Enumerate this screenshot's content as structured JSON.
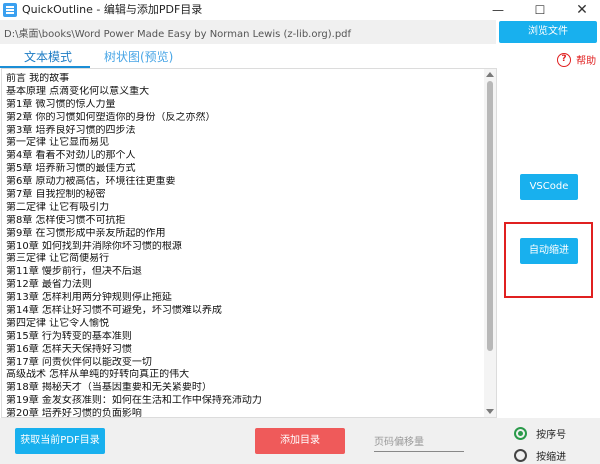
{
  "window": {
    "title": "QuickOutline - 编辑与添加PDF目录",
    "minimize": "—",
    "maximize": "☐",
    "close": "✕"
  },
  "toolbar": {
    "path": "D:\\桌面\\books\\Word Power Made Easy by Norman Lewis (z-lib.org).pdf",
    "browse_label": "浏览文件"
  },
  "tabs": [
    {
      "label": "文本模式",
      "active": true
    },
    {
      "label": "树状图(预览)",
      "active": false
    }
  ],
  "help": {
    "icon": "?",
    "label": "帮助"
  },
  "editor_lines": [
    "前言   我的故事",
    "基本原理 点滴变化何以意义重大",
    "第1章   微习惯的惊人力量",
    "第2章   你的习惯如何塑造你的身份（反之亦然）",
    "第3章   培养良好习惯的四步法",
    "第一定律 让它显而易见",
    "第4章   看着不对劲儿的那个人",
    "第5章   培养新习惯的最佳方式",
    "第6章   原动力被高估，环境往往更重要",
    "第7章   自我控制的秘密",
    "第二定律 让它有吸引力",
    "第8章   怎样使习惯不可抗拒",
    "第9章   在习惯形成中亲友所起的作用",
    "第10章   如何找到并消除你坏习惯的根源",
    "第三定律 让它简便易行",
    "第11章   慢步前行，但决不后退",
    "第12章   最省力法则",
    "第13章   怎样利用两分钟规则停止拖延",
    "第14章   怎样让好习惯不可避免，坏习惯难以养成",
    "第四定律 让它令人愉悦",
    "第15章   行为转变的基本准则",
    "第16章   怎样天天保持好习惯",
    "第17章   问责伙伴何以能改变一切",
    "高级战术 怎样从单纯的好转向真正的伟大",
    "第18章   揭秘天才（当基因重要和无关紧要时）",
    "第19章   金发女孩准则：如何在生活和工作中保持充沛动力",
    "第20章   培养好习惯的负面影响"
  ],
  "side_buttons": {
    "vscode": "VSCode",
    "auto_indent": "自动缩进"
  },
  "bottom": {
    "get_toc": "获取当前PDF目录",
    "add_toc": "添加目录",
    "offset_placeholder": "页码偏移量",
    "radio_seq": "按序号",
    "radio_indent": "按缩进",
    "radio_selected": "radio_seq"
  },
  "colors": {
    "accent": "#18b0ee",
    "danger_button": "#ef5a5a",
    "highlight": "#e02020",
    "radio": "#2a9a4a"
  }
}
